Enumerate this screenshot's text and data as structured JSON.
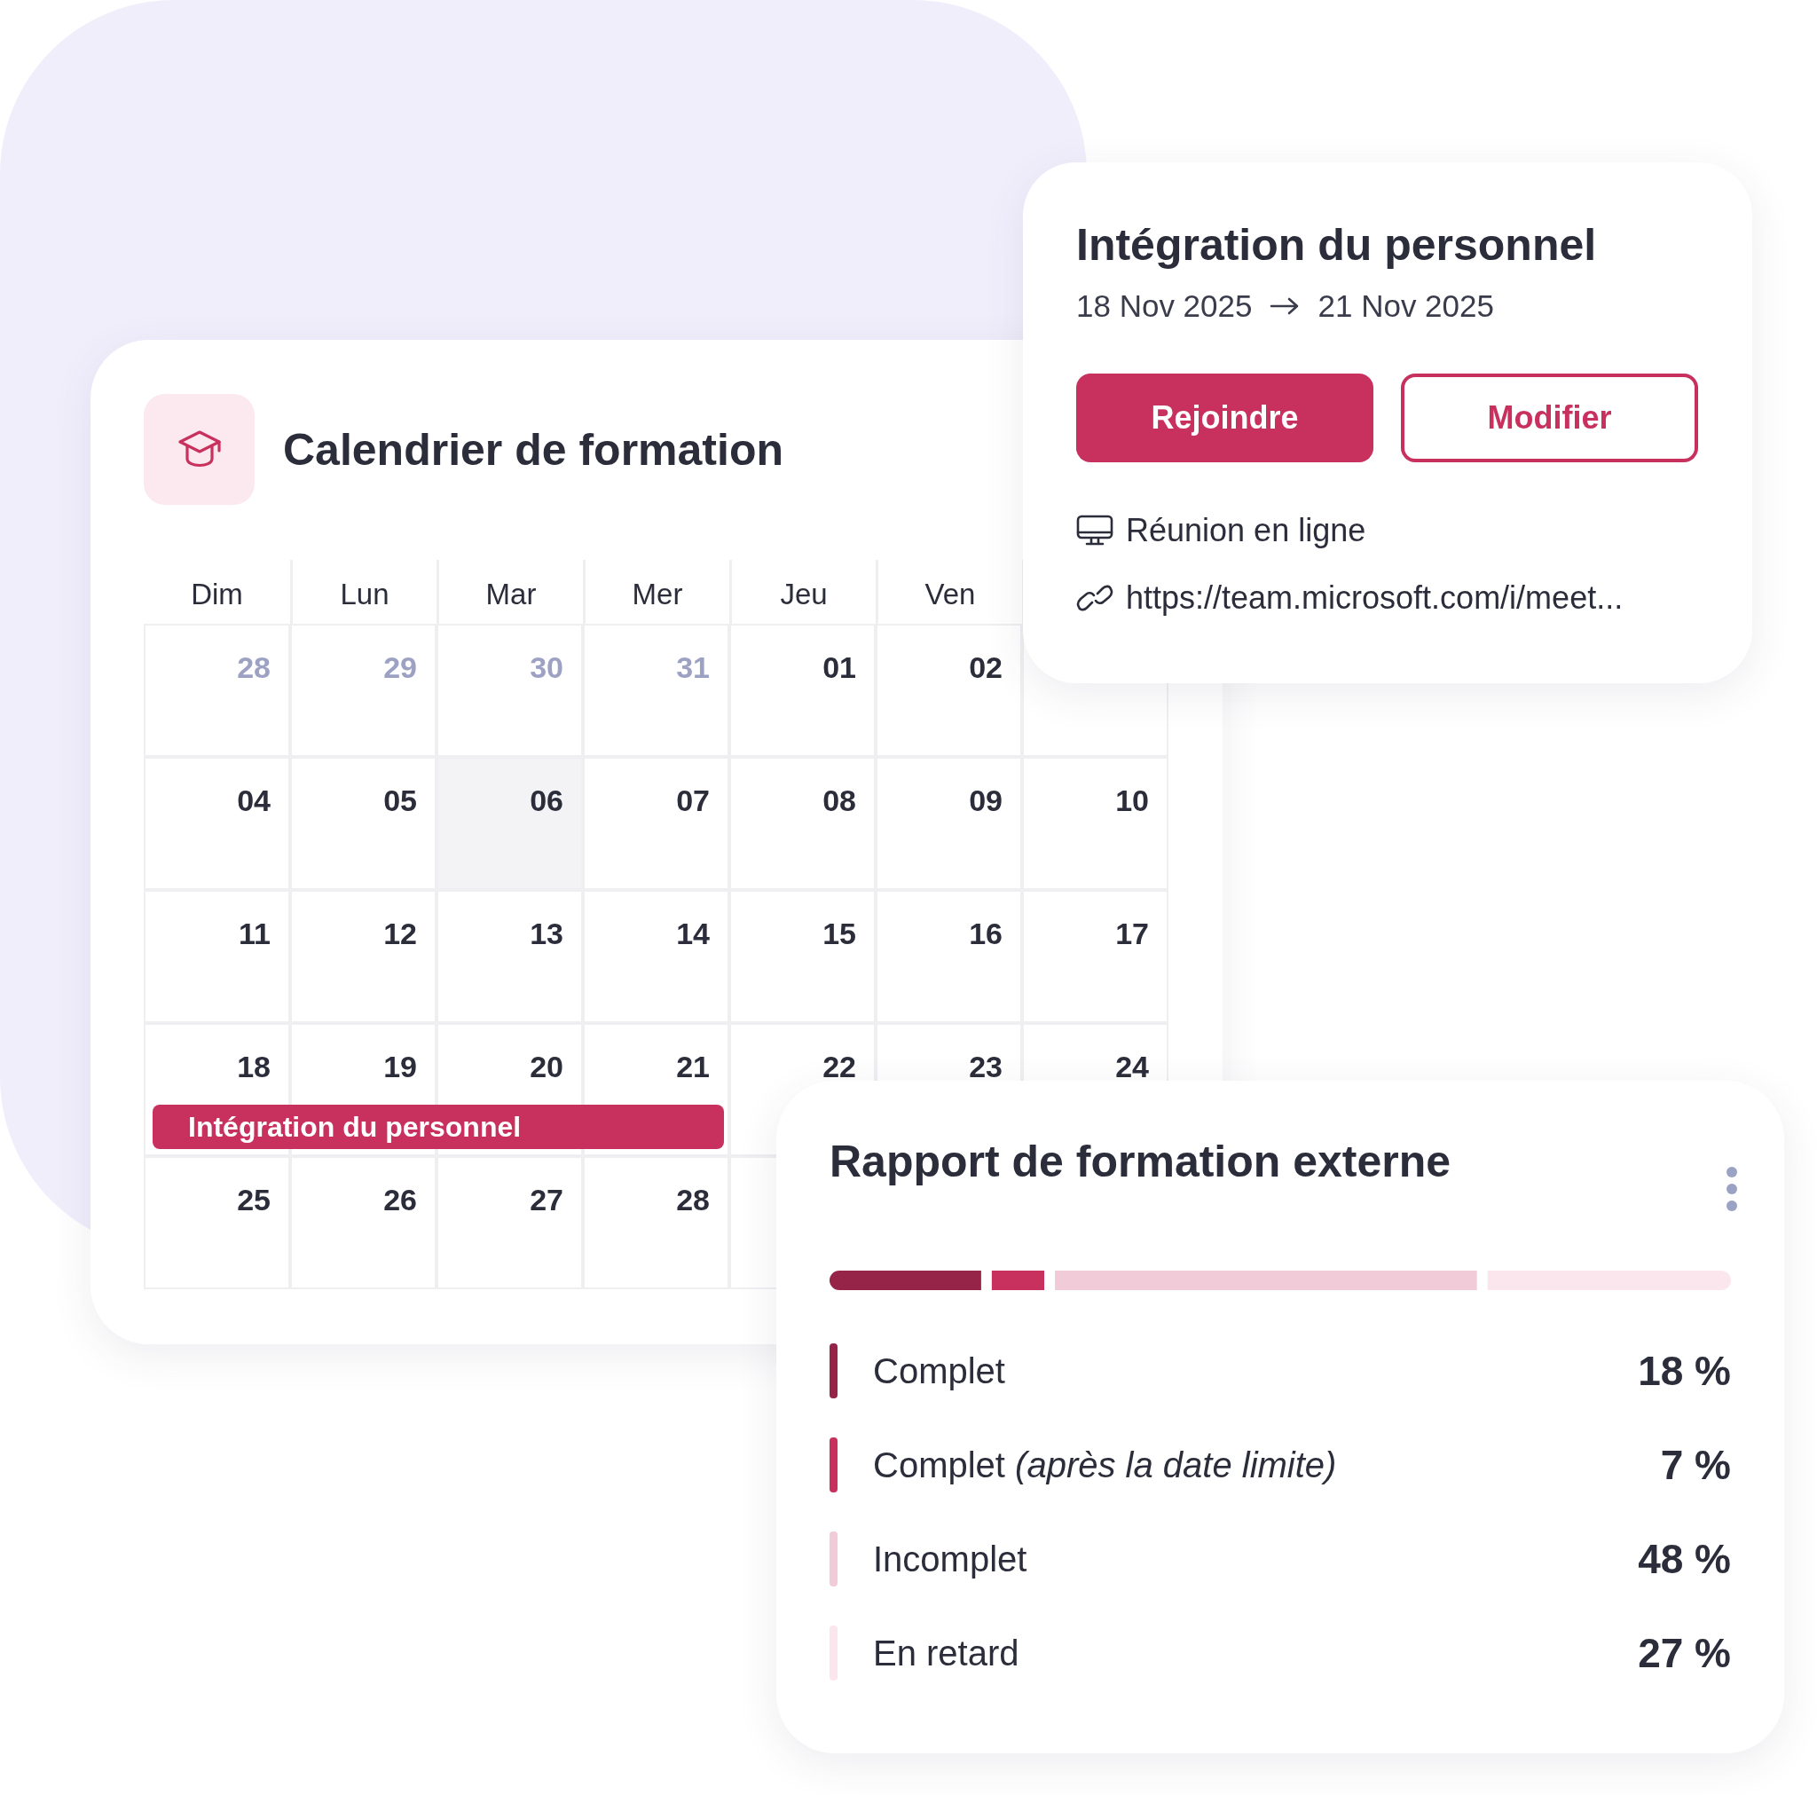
{
  "calendar": {
    "title": "Calendrier de formation",
    "weekdays": [
      "Dim",
      "Lun",
      "Mar",
      "Mer",
      "Jeu",
      "Ven"
    ],
    "weeks": [
      {
        "days": [
          {
            "day": "28",
            "muted": true,
            "highlighted": false,
            "event": false
          },
          {
            "day": "29",
            "muted": true,
            "highlighted": false,
            "event": false
          },
          {
            "day": "30",
            "muted": true,
            "highlighted": false,
            "event": false
          },
          {
            "day": "31",
            "muted": true,
            "highlighted": false,
            "event": false
          },
          {
            "day": "01",
            "muted": false,
            "highlighted": false,
            "event": false
          },
          {
            "day": "02",
            "muted": false,
            "highlighted": false,
            "event": false
          }
        ]
      },
      {
        "days": [
          {
            "day": "04",
            "muted": false,
            "highlighted": false,
            "event": false
          },
          {
            "day": "05",
            "muted": false,
            "highlighted": false,
            "event": false
          },
          {
            "day": "06",
            "muted": false,
            "highlighted": true,
            "event": false
          },
          {
            "day": "07",
            "muted": false,
            "highlighted": false,
            "event": false
          },
          {
            "day": "08",
            "muted": false,
            "highlighted": false,
            "event": false
          },
          {
            "day": "09",
            "muted": false,
            "highlighted": false,
            "event": false
          },
          {
            "day": "10",
            "muted": false,
            "highlighted": false,
            "event": false
          }
        ]
      },
      {
        "days": [
          {
            "day": "11",
            "muted": false,
            "highlighted": false,
            "event": false
          },
          {
            "day": "12",
            "muted": false,
            "highlighted": false,
            "event": false
          },
          {
            "day": "13",
            "muted": false,
            "highlighted": false,
            "event": false
          },
          {
            "day": "14",
            "muted": false,
            "highlighted": false,
            "event": false
          },
          {
            "day": "15",
            "muted": false,
            "highlighted": false,
            "event": false
          },
          {
            "day": "16",
            "muted": false,
            "highlighted": false,
            "event": false
          },
          {
            "day": "17",
            "muted": false,
            "highlighted": false,
            "event": false
          }
        ]
      },
      {
        "event": {
          "label": "Intégration du personnel"
        },
        "days": [
          {
            "day": "18",
            "muted": false,
            "highlighted": false,
            "event": true
          },
          {
            "day": "19",
            "muted": false,
            "highlighted": false,
            "event": true
          },
          {
            "day": "20",
            "muted": false,
            "highlighted": false,
            "event": true
          },
          {
            "day": "21",
            "muted": false,
            "highlighted": false,
            "event": true
          },
          {
            "day": "22",
            "muted": false,
            "highlighted": false,
            "event": false
          },
          {
            "day": "23",
            "muted": false,
            "highlighted": false,
            "event": false
          },
          {
            "day": "24",
            "muted": false,
            "highlighted": false,
            "event": false
          }
        ]
      },
      {
        "days": [
          {
            "day": "25",
            "muted": false,
            "highlighted": false,
            "event": false
          },
          {
            "day": "26",
            "muted": false,
            "highlighted": false,
            "event": false
          },
          {
            "day": "27",
            "muted": false,
            "highlighted": false,
            "event": false
          },
          {
            "day": "28",
            "muted": false,
            "highlighted": false,
            "event": false
          }
        ]
      }
    ]
  },
  "event_popup": {
    "title": "Intégration du personnel",
    "start": "18 Nov 2025",
    "end": "21 Nov 2025",
    "buttons": [
      {
        "label": "Rejoindre",
        "kind": "primary"
      },
      {
        "label": "Modifier",
        "kind": "outline"
      }
    ],
    "details": [
      {
        "kind": "meeting",
        "text": "Réunion en ligne"
      },
      {
        "kind": "link",
        "text": "https://team.microsoft.com/i/meet..."
      }
    ]
  },
  "report": {
    "title": "Rapport de formation externe",
    "items": [
      {
        "label": "Complet",
        "value": "18 %",
        "color": "#952448"
      },
      {
        "label": "Complet *(après la date limite)*",
        "value": "7 %",
        "color": "#c8305d"
      },
      {
        "label": "Incomplet",
        "value": "48 %",
        "color": "#f1cbd7"
      },
      {
        "label": "En retard",
        "value": "27 %",
        "color": "#fae6ec"
      }
    ]
  }
}
